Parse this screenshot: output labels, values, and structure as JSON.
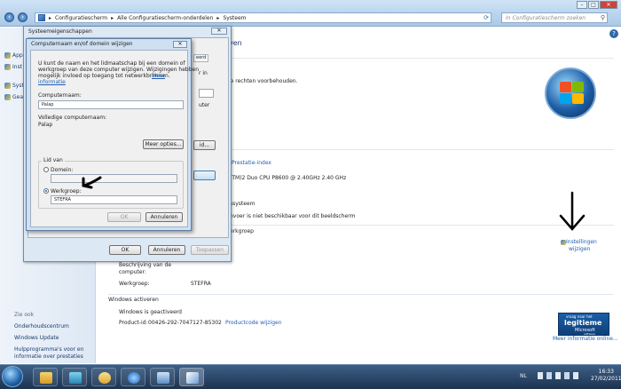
{
  "explorer": {
    "breadcrumb": [
      "Configuratiescherm",
      "Alle Configuratiescherm-onderdelen",
      "Systeem"
    ],
    "search_placeholder": "In Configuratiescherm zoeken",
    "window_buttons": [
      "–",
      "□",
      "✕"
    ]
  },
  "leftnav": {
    "items": [
      "App",
      "Inst verb",
      "Syst",
      "Gea syst"
    ],
    "see_also_title": "Zie ook",
    "see_also": [
      "Onderhoudscentrum",
      "Windows Update",
      "Hulpprogramma's voor en",
      "informatie over prestaties"
    ]
  },
  "main": {
    "partial_heading": "ven",
    "rights": "le rechten voorbehouden.",
    "perf_link": "Prestatie-index",
    "cpu": "(TM)2 Duo CPU    P8600  @ 2.40GHz   2.40 GHz",
    "systype": "ssysteem",
    "pen": "nvoer is niet beschikbaar voor dit beeldscherm",
    "workgroup_section": "erkgroep",
    "settings_link_1": "Instellingen",
    "settings_link_2": "wijzigen",
    "desc_label_1": "Beschrijving van de",
    "desc_label_2": "computer:",
    "workgroup_label": "Werkgroep:",
    "workgroup_value": "STEFRA",
    "activation_title": "Windows activeren",
    "activation_status": "Windows is geactiveerd",
    "product_id_label": "Product-id:",
    "product_id": "00426-292-7047127-85302",
    "product_key_link": "Productcode wijzigen",
    "genuine_small": "vraag naar het",
    "genuine_big": "legitieme",
    "genuine_ms": "Microsoft",
    "genuine_sw": "software",
    "more_info": "Meer informatie online..."
  },
  "sysprops": {
    "title": "Systeemeigenschappen",
    "close": "✕",
    "tab_partial": "eerd",
    "partial_r": "r in",
    "partial_uter": "uter",
    "change_partial": "id...",
    "ok": "OK",
    "cancel": "Annuleren",
    "apply": "Toepassen"
  },
  "rename": {
    "title": "Computernaam en/of domein wijzigen",
    "close": "✕",
    "intro": [
      "U kunt de naam en het lidmaatschap bij een domein of",
      "werkgroep van deze computer wijzigen. Wijzigingen hebben",
      "mogelijk invloed op toegang tot netwerkbronnen."
    ],
    "intro_link_1": "Meer",
    "intro_link_2": "informatie",
    "computer_name_label": "Computernaam:",
    "computer_name": "Palap",
    "full_name_label": "Volledige computernaam:",
    "full_name": "Palap",
    "more_button": "Meer opties...",
    "member_of": "Lid van",
    "domain_label": "Domein:",
    "workgroup_label": "Werkgroep:",
    "workgroup_value": "STEFRA",
    "ok": "OK",
    "cancel": "Annuleren"
  },
  "taskbar": {
    "lang": "NL",
    "time": "16:33",
    "date": "27/02/2011"
  },
  "colors": {
    "link": "#1e5fb4",
    "title_blue": "#1b3a6b"
  }
}
